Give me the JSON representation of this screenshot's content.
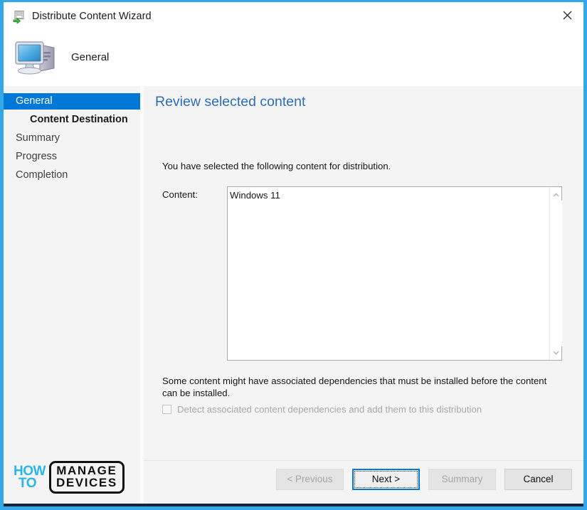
{
  "window": {
    "title": "Distribute Content Wizard",
    "title_icon": "distribute-content-icon",
    "close_icon": "close-icon",
    "accent_color": "#33A7E8"
  },
  "header": {
    "title": "General",
    "icon": "computer-icon"
  },
  "sidebar": {
    "items": [
      {
        "label": "General",
        "state": "selected",
        "indent": false
      },
      {
        "label": "Content Destination",
        "state": "current",
        "indent": true
      },
      {
        "label": "Summary",
        "state": "normal",
        "indent": false
      },
      {
        "label": "Progress",
        "state": "normal",
        "indent": false
      },
      {
        "label": "Completion",
        "state": "normal",
        "indent": false
      }
    ],
    "selected_color": "#0078D7"
  },
  "main": {
    "heading": "Review selected content",
    "heading_color": "#2f6cb5",
    "intro_text": "You have selected the following content for distribution.",
    "content_label": "Content:",
    "content_items": [
      "Windows 11"
    ],
    "scrollbar": {
      "up_icon": "chevron-up-icon",
      "down_icon": "chevron-down-icon"
    },
    "dependency_note": "Some content might have associated dependencies that must be installed before the content can be installed.",
    "dependency_checkbox": {
      "label": "Detect associated content dependencies and add them to this distribution",
      "checked": false,
      "enabled": false
    }
  },
  "footer": {
    "buttons": [
      {
        "id": "previous",
        "label": "< Previous",
        "enabled": false,
        "default": false
      },
      {
        "id": "next",
        "label": "Next >",
        "enabled": true,
        "default": true
      },
      {
        "id": "summary",
        "label": "Summary",
        "enabled": false,
        "default": false
      },
      {
        "id": "cancel",
        "label": "Cancel",
        "enabled": true,
        "default": false
      }
    ]
  },
  "watermark": {
    "how": "HOW",
    "to": "TO",
    "manage": "MANAGE",
    "devices": "DEVICES",
    "accent_color": "#2BB6E8"
  }
}
